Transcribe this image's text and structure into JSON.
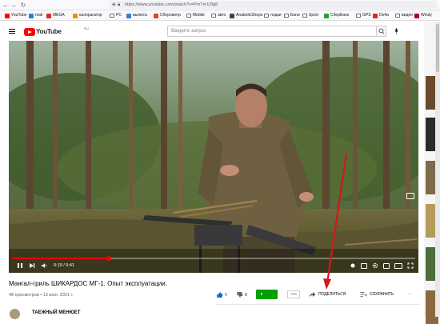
{
  "browser": {
    "url": "https://www.youtube.com/watch?v=PmTm12fg8",
    "bookmarks": [
      {
        "label": "YouTube",
        "color": "#ff0000",
        "kind": "site"
      },
      {
        "label": "mail",
        "color": "#2a7fd4",
        "kind": "site"
      },
      {
        "label": "MEGA",
        "color": "#d9272e",
        "kind": "site"
      },
      {
        "label": "калорагатор",
        "color": "#ff8800",
        "kind": "site"
      },
      {
        "label": "PC",
        "kind": "folder"
      },
      {
        "label": "вылюта",
        "color": "#3a7bd5",
        "kind": "site"
      },
      {
        "label": "Сберометр",
        "color": "#e53935",
        "kind": "site"
      },
      {
        "label": "Mobile",
        "kind": "folder"
      },
      {
        "label": "авто",
        "kind": "folder"
      },
      {
        "label": "AnabolicShops",
        "color": "#444444",
        "kind": "site"
      },
      {
        "label": "лодки",
        "kind": "folder"
      },
      {
        "label": "Бани",
        "kind": "folder"
      },
      {
        "label": "Sport",
        "kind": "folder"
      },
      {
        "label": "СберБанк",
        "color": "#21a038",
        "kind": "site"
      },
      {
        "label": "GPS",
        "kind": "folder"
      },
      {
        "label": "Do4a",
        "color": "#d9272e",
        "kind": "site"
      },
      {
        "label": "видео",
        "kind": "folder"
      },
      {
        "label": "Windy",
        "color": "#b00020",
        "kind": "site"
      }
    ]
  },
  "youtube": {
    "logo_text": "YouTube",
    "region": "RU",
    "search_placeholder": "Введите запрос"
  },
  "video": {
    "time_display": "0:19 / 9:41",
    "progress": 0.24,
    "title": "Мангал-гриль ШИКАРДОС МГ-1. Опыт эксплуатации.",
    "views_date": "48 просмотров • 13 июл. 2021 г.",
    "likes": "9",
    "dislikes": "0",
    "download_label": "Скачать",
    "quality_label": "720",
    "share_label": "ПОДЕЛИТЬСЯ",
    "save_label": "СОХРАНИТЬ",
    "more_label": "...",
    "channel_name": "ТАЕЖНЫЙ МЕНЮЕТ"
  },
  "colors": {
    "accent": "#ff0000",
    "like_blue": "#065fd4",
    "download_green": "#00a000",
    "annotation_arrow": "#d0191a"
  }
}
